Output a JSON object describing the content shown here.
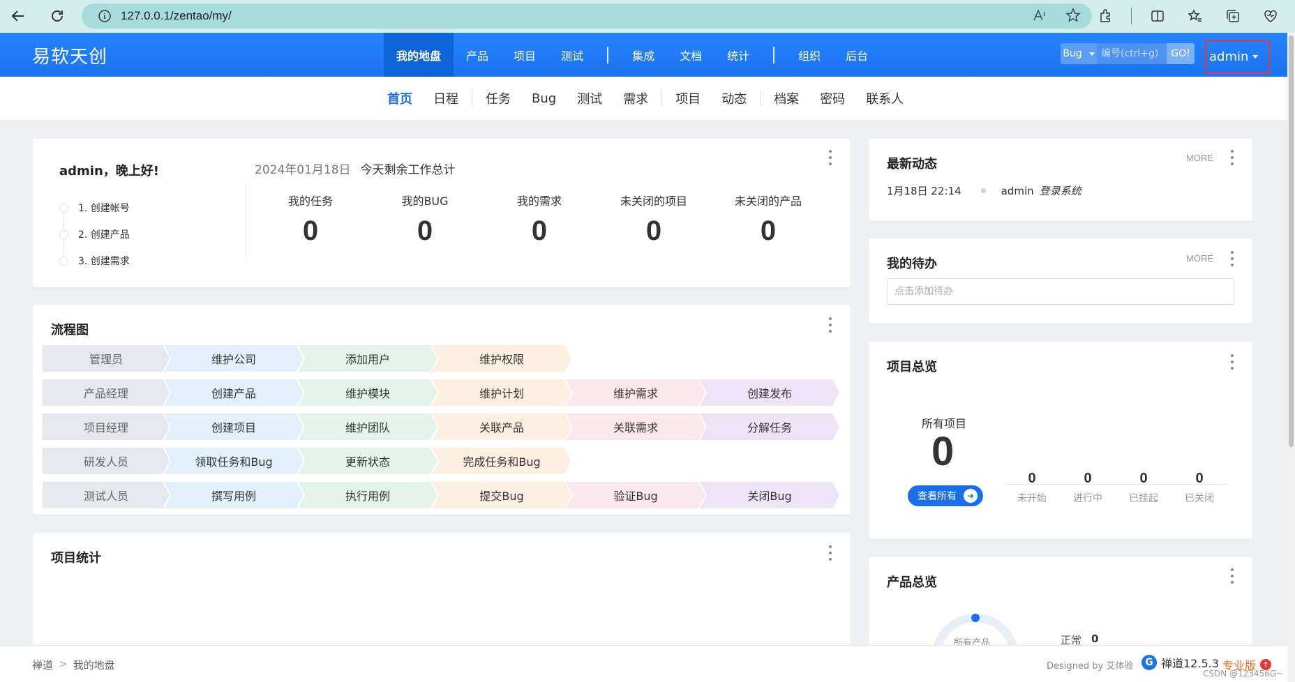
{
  "browser": {
    "url": "127.0.0.1/zentao/my/"
  },
  "header": {
    "brand": "易软天创",
    "nav": [
      {
        "label": "我的地盘",
        "active": true
      },
      {
        "label": "产品"
      },
      {
        "label": "项目"
      },
      {
        "label": "测试"
      },
      {
        "label": "集成"
      },
      {
        "label": "文档"
      },
      {
        "label": "统计"
      },
      {
        "label": "组织"
      },
      {
        "label": "后台"
      }
    ],
    "search_type": "Bug",
    "search_placeholder": "编号(ctrl+g)",
    "go_label": "GO!",
    "user": "admin"
  },
  "subnav": [
    {
      "label": "首页",
      "active": true
    },
    {
      "label": "日程"
    },
    {
      "label": "任务"
    },
    {
      "label": "Bug"
    },
    {
      "label": "测试"
    },
    {
      "label": "需求"
    },
    {
      "label": "项目"
    },
    {
      "label": "动态"
    },
    {
      "label": "档案"
    },
    {
      "label": "密码"
    },
    {
      "label": "联系人"
    }
  ],
  "welcome": {
    "greeting": "admin，晚上好!",
    "steps": [
      "1. 创建帐号",
      "2. 创建产品",
      "3. 创建需求"
    ],
    "date": "2024年01月18日",
    "summary_title": "今天剩余工作总计",
    "stats": [
      {
        "label": "我的任务",
        "value": "0"
      },
      {
        "label": "我的BUG",
        "value": "0"
      },
      {
        "label": "我的需求",
        "value": "0"
      },
      {
        "label": "未关闭的项目",
        "value": "0"
      },
      {
        "label": "未关闭的产品",
        "value": "0"
      }
    ]
  },
  "flow": {
    "title": "流程图",
    "rows": [
      {
        "role": "管理员",
        "steps": [
          "维护公司",
          "添加用户",
          "维护权限"
        ]
      },
      {
        "role": "产品经理",
        "steps": [
          "创建产品",
          "维护模块",
          "维护计划",
          "维护需求",
          "创建发布"
        ]
      },
      {
        "role": "项目经理",
        "steps": [
          "创建项目",
          "维护团队",
          "关联产品",
          "关联需求",
          "分解任务"
        ]
      },
      {
        "role": "研发人员",
        "steps": [
          "领取任务和Bug",
          "更新状态",
          "完成任务和Bug"
        ]
      },
      {
        "role": "测试人员",
        "steps": [
          "撰写用例",
          "执行用例",
          "提交Bug",
          "验证Bug",
          "关闭Bug"
        ]
      }
    ]
  },
  "project_stats": {
    "title": "项目统计"
  },
  "activity": {
    "title": "最新动态",
    "more": "MORE",
    "items": [
      {
        "time": "1月18日 22:14",
        "user": "admin",
        "action": "登录系统"
      }
    ]
  },
  "todo": {
    "title": "我的待办",
    "more": "MORE",
    "placeholder": "点击添加待办"
  },
  "projects": {
    "title": "项目总览",
    "all_label": "所有项目",
    "all_value": "0",
    "view_all": "查看所有",
    "statuses": [
      {
        "label": "未开始",
        "value": "0"
      },
      {
        "label": "进行中",
        "value": "0"
      },
      {
        "label": "已挂起",
        "value": "0"
      },
      {
        "label": "已关闭",
        "value": "0"
      }
    ]
  },
  "products": {
    "title": "产品总览",
    "all_label": "所有产品",
    "normal_label": "正常",
    "normal_value": "0"
  },
  "footer": {
    "crumbs": [
      "禅道",
      "我的地盘"
    ],
    "designed": "Designed by 艾体验",
    "version": "禅道12.5.3",
    "edition": "专业版",
    "watermark": "CSDN @123456G~"
  },
  "colors": {
    "nav": "#1e7cff",
    "nav_active": "#0c64d8",
    "accent": "#1a6fe8",
    "highlight_border": "#e53935"
  }
}
